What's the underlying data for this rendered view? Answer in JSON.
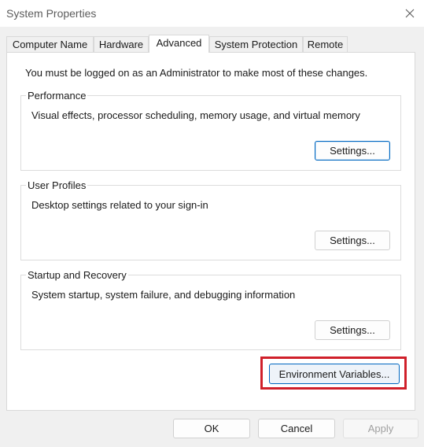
{
  "window": {
    "title": "System Properties",
    "close_icon": "close-icon"
  },
  "tabs": [
    {
      "label": "Computer Name",
      "active": false
    },
    {
      "label": "Hardware",
      "active": false
    },
    {
      "label": "Advanced",
      "active": true
    },
    {
      "label": "System Protection",
      "active": false
    },
    {
      "label": "Remote",
      "active": false
    }
  ],
  "advanced": {
    "admin_note": "You must be logged on as an Administrator to make most of these changes.",
    "performance": {
      "legend": "Performance",
      "description": "Visual effects, processor scheduling, memory usage, and virtual memory",
      "button": "Settings..."
    },
    "user_profiles": {
      "legend": "User Profiles",
      "description": "Desktop settings related to your sign-in",
      "button": "Settings..."
    },
    "startup_recovery": {
      "legend": "Startup and Recovery",
      "description": "System startup, system failure, and debugging information",
      "button": "Settings..."
    },
    "environment_button": "Environment Variables...",
    "highlight_color": "#d0202a"
  },
  "footer": {
    "ok": "OK",
    "cancel": "Cancel",
    "apply": "Apply"
  },
  "colors": {
    "accent": "#0067c0",
    "window_bg": "#f0f0f0",
    "panel_bg": "#ffffff"
  }
}
